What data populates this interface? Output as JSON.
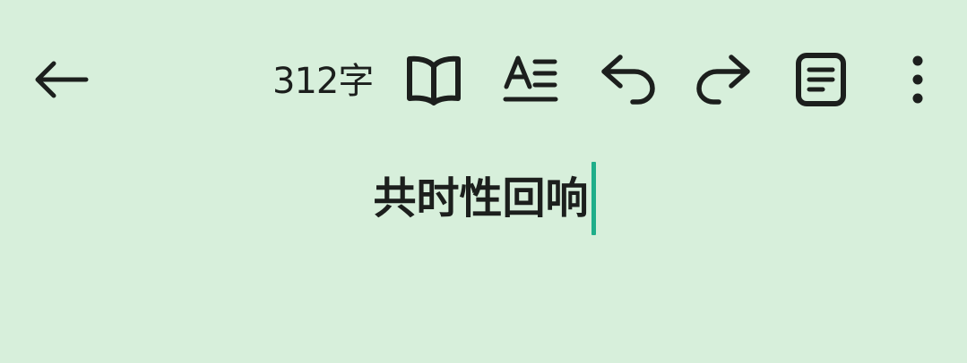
{
  "toolbar": {
    "word_count": "312字",
    "icons": {
      "back": "arrow-left-icon",
      "reading_mode": "open-book-icon",
      "text_format": "text-format-icon",
      "undo": "undo-icon",
      "redo": "redo-icon",
      "notes": "notes-icon",
      "more": "more-vertical-icon"
    }
  },
  "document": {
    "title": "共时性回响"
  },
  "colors": {
    "background": "#d7efdb",
    "text": "#1c1f1d",
    "caret": "#1fae8a"
  }
}
